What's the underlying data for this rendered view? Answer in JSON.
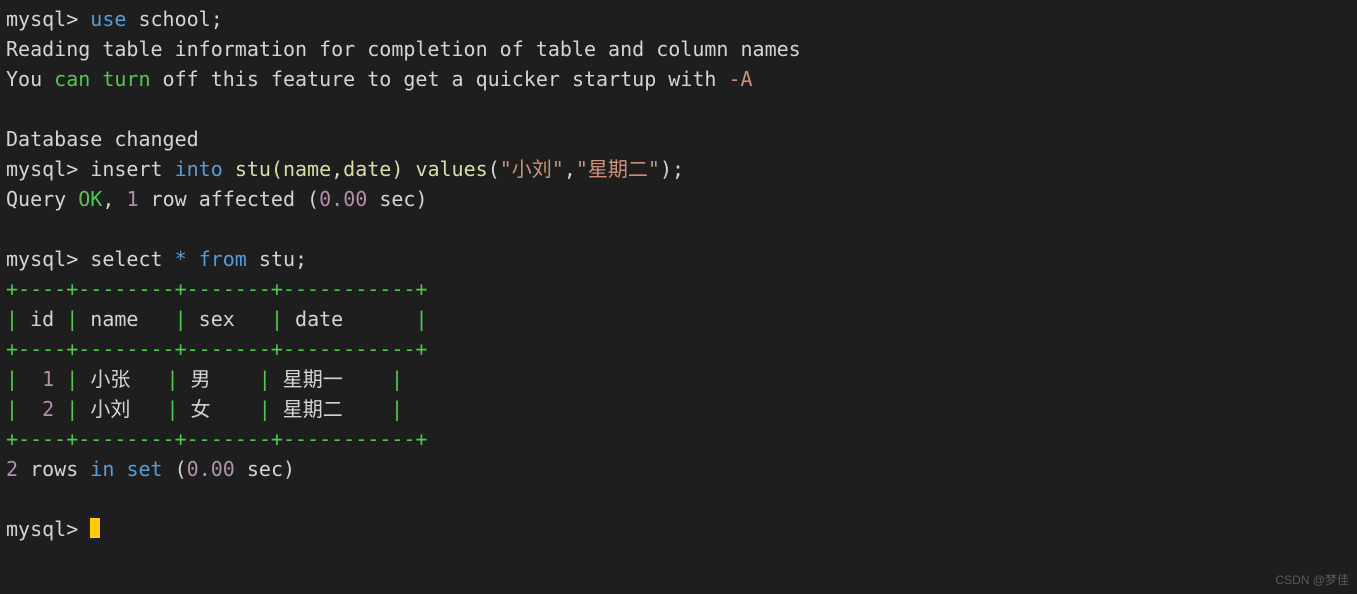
{
  "prompt": "mysql>",
  "lines": {
    "l1_cmd": "use school;",
    "l1_kw_use": "use",
    "l1_rest": " school;",
    "l2": "Reading table information for completion of table and column names",
    "l3_a": "You ",
    "l3_can": "can",
    "l3_sp": " ",
    "l3_turn": "turn",
    "l3_b": " off this feature to get a quicker startup with ",
    "l3_flag": "-A",
    "l5": "Database changed",
    "l6_a": "insert ",
    "l6_into": "into",
    "l6_b": " ",
    "l6_fn": "stu(name,date)",
    "l6_c": " ",
    "l6_values": "values",
    "l6_d": "(",
    "l6_s1": "\"小刘\"",
    "l6_e": ",",
    "l6_s2": "\"星期二\"",
    "l6_f": ");",
    "l7_a": "Query ",
    "l7_ok": "OK",
    "l7_b": ", ",
    "l7_n1": "1",
    "l7_c": " row affected (",
    "l7_n2": "0.00",
    "l7_d": " sec)",
    "l9_a": "select ",
    "l9_star": "*",
    "l9_b": " ",
    "l9_from": "from",
    "l9_c": " stu;",
    "border": "+----+--------+-------+-----------+",
    "hdr_pipe": "|",
    "hdr_id": " id ",
    "hdr_name": " name   ",
    "hdr_sex": " sex   ",
    "hdr_date": " date      ",
    "r1_id": "  1 ",
    "r1_id_num": "1",
    "r1_name": " 小张   ",
    "r1_sex": " 男    ",
    "r1_date": " 星期一    ",
    "r2_id": "  2 ",
    "r2_id_num": "2",
    "r2_name": " 小刘   ",
    "r2_sex": " 女    ",
    "r2_date": " 星期二    ",
    "foot_n": "2",
    "foot_a": " rows ",
    "foot_in": "in",
    "foot_b": " ",
    "foot_set": "set",
    "foot_c": " (",
    "foot_t": "0.00",
    "foot_d": " sec)"
  },
  "table": {
    "columns": [
      "id",
      "name",
      "sex",
      "date"
    ],
    "rows": [
      {
        "id": 1,
        "name": "小张",
        "sex": "男",
        "date": "星期一"
      },
      {
        "id": 2,
        "name": "小刘",
        "sex": "女",
        "date": "星期二"
      }
    ]
  },
  "watermark": "CSDN @梦佳"
}
